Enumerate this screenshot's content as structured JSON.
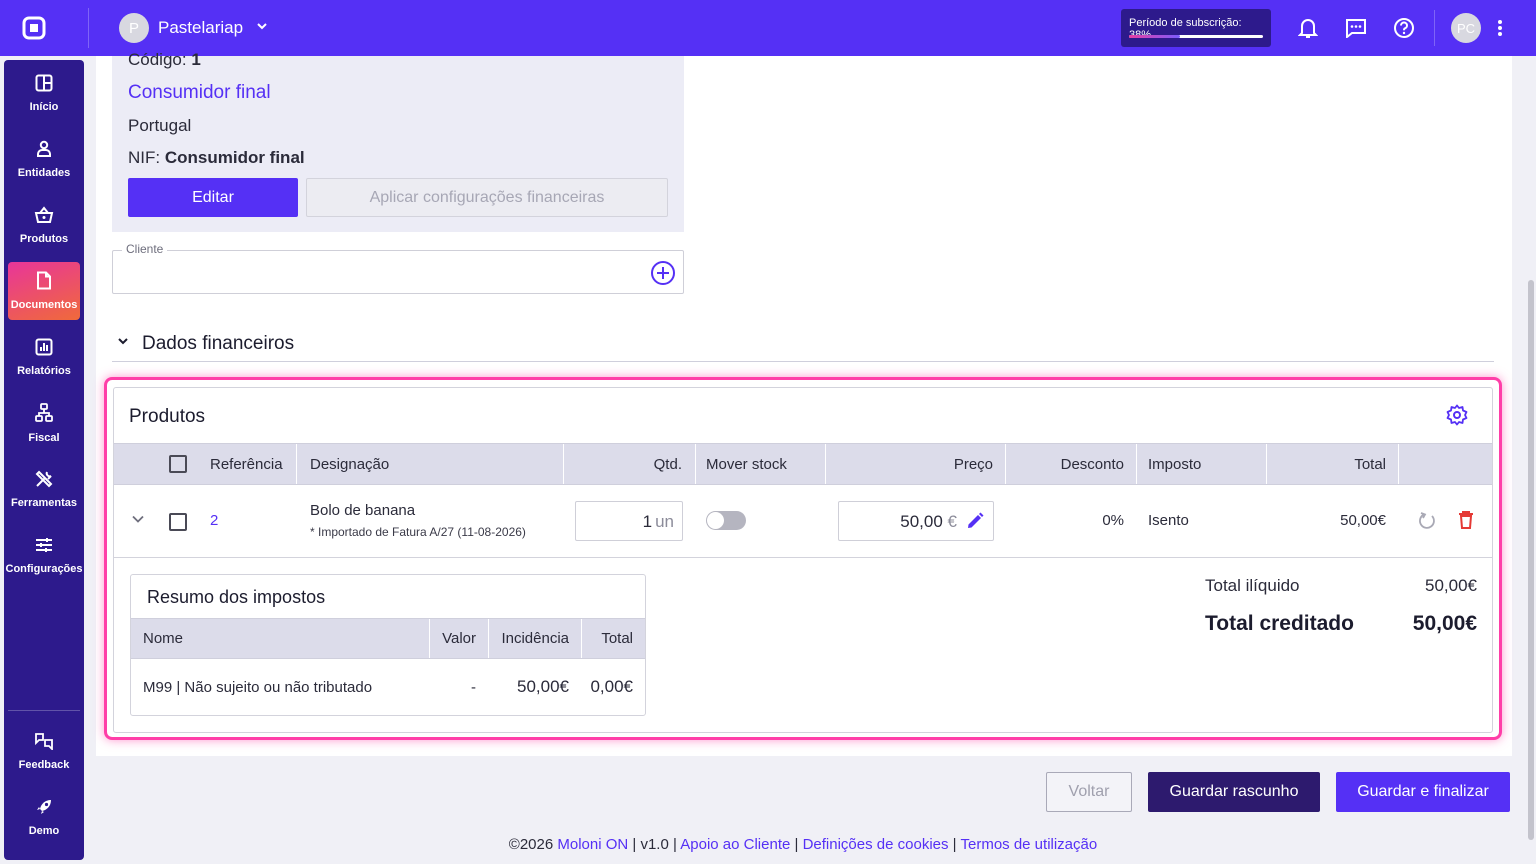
{
  "topbar": {
    "company_initial": "P",
    "company_name": "Pastelariap",
    "subscription_label": "Período de subscrição: 38%",
    "subscription_progress": 0.38,
    "user_initials": "PC"
  },
  "sidebar": {
    "items": [
      {
        "label": "Início",
        "icon": "home-icon"
      },
      {
        "label": "Entidades",
        "icon": "person-icon"
      },
      {
        "label": "Produtos",
        "icon": "basket-icon"
      },
      {
        "label": "Documentos",
        "icon": "document-icon",
        "active": true
      },
      {
        "label": "Relatórios",
        "icon": "report-icon"
      },
      {
        "label": "Fiscal",
        "icon": "fiscal-icon"
      },
      {
        "label": "Ferramentas",
        "icon": "tools-icon"
      },
      {
        "label": "Configurações",
        "icon": "sliders-icon"
      }
    ],
    "bottom": [
      {
        "label": "Feedback",
        "icon": "feedback-icon"
      },
      {
        "label": "Demo",
        "icon": "rocket-icon"
      }
    ]
  },
  "client": {
    "code_label": "Código:",
    "code_value": "1",
    "name": "Consumidor final",
    "country": "Portugal",
    "nif_label": "NIF:",
    "nif_value": "Consumidor final",
    "edit_label": "Editar",
    "apply_label": "Aplicar configurações financeiras",
    "field_label": "Cliente"
  },
  "financial": {
    "title": "Dados financeiros"
  },
  "products": {
    "title": "Produtos",
    "columns": [
      "Referência",
      "Designação",
      "Qtd.",
      "Mover stock",
      "Preço",
      "Desconto",
      "Imposto",
      "Total"
    ],
    "rows": [
      {
        "reference": "2",
        "name": "Bolo de banana",
        "note": "* Importado de Fatura A/27 (11-08-2026)",
        "qty": "1",
        "unit": "un",
        "move_stock": false,
        "price": "50,00",
        "currency": "€",
        "discount": "0%",
        "tax": "Isento",
        "total": "50,00€"
      }
    ]
  },
  "tax_summary": {
    "title": "Resumo dos impostos",
    "columns": [
      "Nome",
      "Valor",
      "Incidência",
      "Total"
    ],
    "rows": [
      {
        "name": "M99 | Não sujeito ou não tributado",
        "value": "-",
        "incidence": "50,00€",
        "total": "0,00€"
      }
    ]
  },
  "totals": {
    "net_label": "Total ilíquido",
    "net_value": "50,00€",
    "credited_label": "Total creditado",
    "credited_value": "50,00€"
  },
  "actions": {
    "back": "Voltar",
    "save_draft": "Guardar rascunho",
    "save_finalize": "Guardar e finalizar"
  },
  "footer": {
    "copyright": "©2026",
    "brand": "Moloni ON",
    "version": "v1.0",
    "support": "Apoio ao Cliente",
    "cookies": "Definições de cookies",
    "terms": "Termos de utilização",
    "separator": "|"
  },
  "colors": {
    "primary": "#5530f5",
    "sidebar": "#2d1a8c",
    "highlight": "#ff3ea8",
    "danger": "#e53935"
  }
}
